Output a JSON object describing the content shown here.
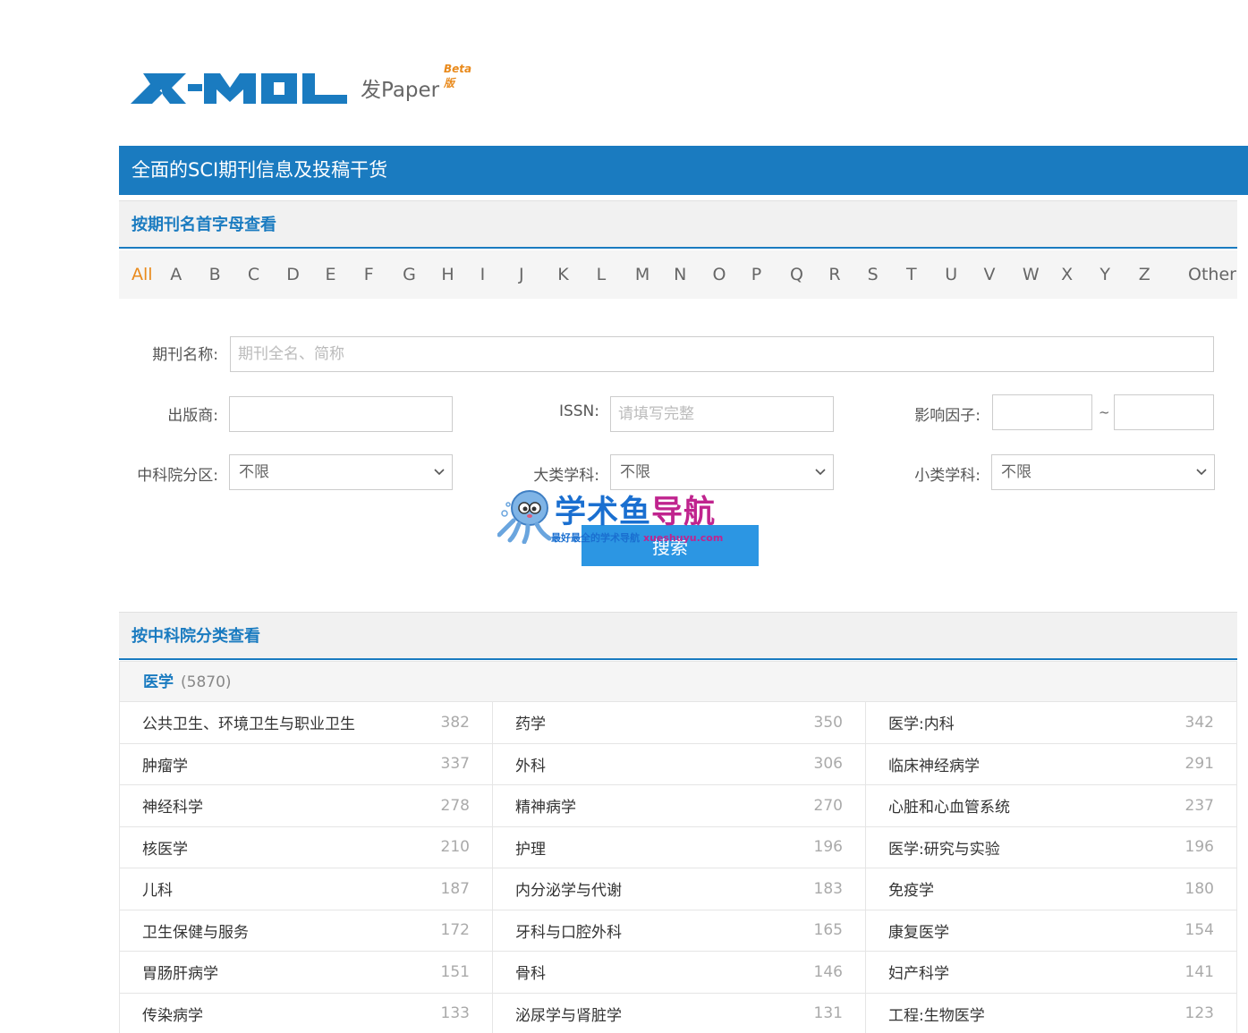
{
  "logo": {
    "brand": "X-MOL",
    "sub": "发Paper",
    "beta": "Beta版"
  },
  "banner": {
    "title": "全面的SCI期刊信息及投稿干货"
  },
  "alphabet_section": {
    "title": "按期刊名首字母查看",
    "letters": [
      "All",
      "A",
      "B",
      "C",
      "D",
      "E",
      "F",
      "G",
      "H",
      "I",
      "J",
      "K",
      "L",
      "M",
      "N",
      "O",
      "P",
      "Q",
      "R",
      "S",
      "T",
      "U",
      "V",
      "W",
      "X",
      "Y",
      "Z"
    ],
    "other": "Other",
    "active": "All"
  },
  "form": {
    "journal_label": "期刊名称:",
    "journal_placeholder": "期刊全名、简称",
    "publisher_label": "出版商:",
    "publisher_value": "",
    "issn_label": "ISSN:",
    "issn_placeholder": "请填写完整",
    "if_label": "影响因子:",
    "if_from": "",
    "if_to": "",
    "tilde": "~",
    "cas_label": "中科院分区:",
    "cas_value": "不限",
    "major_label": "大类学科:",
    "major_value": "不限",
    "minor_label": "小类学科:",
    "minor_value": "不限",
    "search_label": "搜索"
  },
  "watermark": {
    "title_a": "学术鱼",
    "title_b": "导航",
    "sub_a": "最好最全的学术导航",
    "sub_b": "xueshuyu.com"
  },
  "cas_section": {
    "title": "按中科院分类查看",
    "category": "医学",
    "category_count": "(5870)",
    "rows": [
      {
        "name": "公共卫生、环境卫生与职业卫生",
        "count": "382"
      },
      {
        "name": "药学",
        "count": "350"
      },
      {
        "name": "医学:内科",
        "count": "342"
      },
      {
        "name": "肿瘤学",
        "count": "337"
      },
      {
        "name": "外科",
        "count": "306"
      },
      {
        "name": "临床神经病学",
        "count": "291"
      },
      {
        "name": "神经科学",
        "count": "278"
      },
      {
        "name": "精神病学",
        "count": "270"
      },
      {
        "name": "心脏和心血管系统",
        "count": "237"
      },
      {
        "name": "核医学",
        "count": "210"
      },
      {
        "name": "护理",
        "count": "196"
      },
      {
        "name": "医学:研究与实验",
        "count": "196"
      },
      {
        "name": "儿科",
        "count": "187"
      },
      {
        "name": "内分泌学与代谢",
        "count": "183"
      },
      {
        "name": "免疫学",
        "count": "180"
      },
      {
        "name": "卫生保健与服务",
        "count": "172"
      },
      {
        "name": "牙科与口腔外科",
        "count": "165"
      },
      {
        "name": "康复医学",
        "count": "154"
      },
      {
        "name": "胃肠肝病学",
        "count": "151"
      },
      {
        "name": "骨科",
        "count": "146"
      },
      {
        "name": "妇产科学",
        "count": "141"
      },
      {
        "name": "传染病学",
        "count": "133"
      },
      {
        "name": "泌尿学与肾脏学",
        "count": "131"
      },
      {
        "name": "工程:生物医学",
        "count": "123"
      }
    ]
  },
  "colors": {
    "primary": "#1a7bc0",
    "accent": "#e98a1c",
    "button": "#2c96e3"
  }
}
